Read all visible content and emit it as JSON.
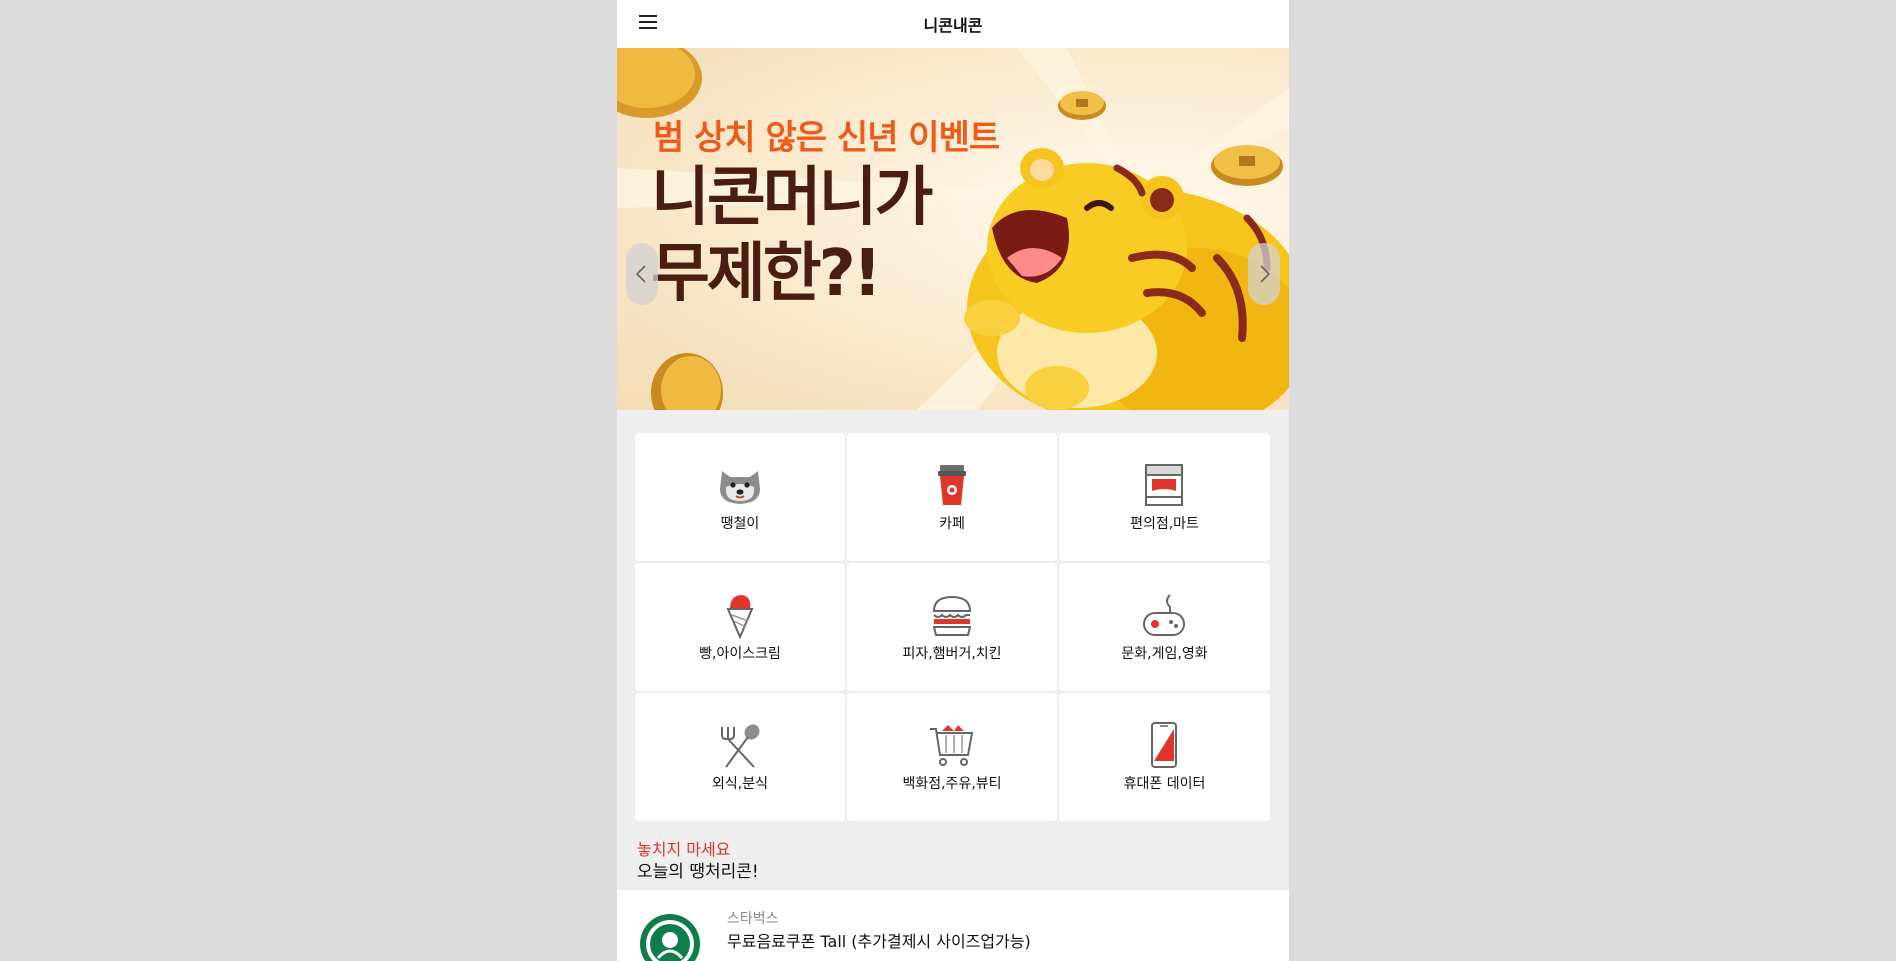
{
  "header": {
    "title": "니콘내콘"
  },
  "banner": {
    "subtitle": "범 상치 않은 신년 이벤트",
    "headline_line1": "니콘머니가",
    "headline_line2": "무제한?!",
    "slide_count": 3,
    "active_slide": 1
  },
  "categories": [
    {
      "label": "땡철이",
      "icon": "dog-icon"
    },
    {
      "label": "카페",
      "icon": "coffee-cup-icon"
    },
    {
      "label": "편의점,마트",
      "icon": "store-icon"
    },
    {
      "label": "빵,아이스크림",
      "icon": "ice-cream-icon"
    },
    {
      "label": "피자,햄버거,치킨",
      "icon": "burger-icon"
    },
    {
      "label": "문화,게임,영화",
      "icon": "gamepad-icon"
    },
    {
      "label": "외식,분식",
      "icon": "fork-spoon-icon"
    },
    {
      "label": "백화점,주유,뷰티",
      "icon": "shopping-cart-icon"
    },
    {
      "label": "휴대폰 데이터",
      "icon": "smartphone-icon"
    }
  ],
  "promo": {
    "subtitle": "놓치지 마세요",
    "title": "오늘의 땡처리콘!"
  },
  "deal": {
    "brand": "스타벅스",
    "name": "무료음료쿠폰 Tall (추가결제시 사이즈업가능)"
  },
  "colors": {
    "accent": "#e0352b",
    "background": "#eeeeee",
    "banner_orange": "#ee5a1a",
    "banner_brown": "#4a1d12",
    "starbucks_green": "#0d7d4a"
  }
}
